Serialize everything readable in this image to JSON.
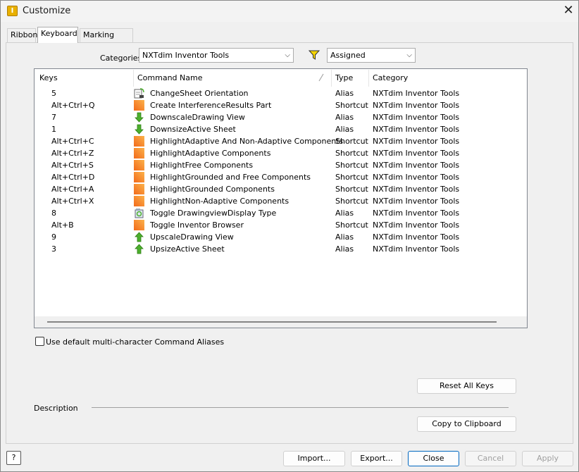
{
  "window": {
    "title": "Customize",
    "close_glyph": "✕",
    "app_icon_letter": "I"
  },
  "tabs": [
    {
      "label": "Ribbon"
    },
    {
      "label": "Keyboard"
    },
    {
      "label": "Marking Menu"
    }
  ],
  "filters": {
    "categories_label": "Categories",
    "categories_value": "NXTdim Inventor Tools",
    "filter_value": "Assigned",
    "chevron": "⌵"
  },
  "table": {
    "columns": [
      "Keys",
      "Command Name",
      "Type",
      "Category"
    ],
    "rows": [
      {
        "keys": "5",
        "command": "ChangeSheet Orientation",
        "type": "Alias",
        "category": "NXTdim Inventor Tools",
        "icon": "sheet-orientation-icon"
      },
      {
        "keys": "Alt+Ctrl+Q",
        "command": "Create InterferenceResults Part",
        "type": "Shortcut",
        "category": "NXTdim Inventor Tools",
        "icon": "orange-gradient-icon"
      },
      {
        "keys": "7",
        "command": "DownscaleDrawing View",
        "type": "Alias",
        "category": "NXTdim Inventor Tools",
        "icon": "green-down-arrow-icon"
      },
      {
        "keys": "1",
        "command": "DownsizeActive Sheet",
        "type": "Alias",
        "category": "NXTdim Inventor Tools",
        "icon": "green-down-arrow-icon"
      },
      {
        "keys": "Alt+Ctrl+C",
        "command": "HighlightAdaptive And Non-Adaptive Components",
        "type": "Shortcut",
        "category": "NXTdim Inventor Tools",
        "icon": "orange-gradient-icon"
      },
      {
        "keys": "Alt+Ctrl+Z",
        "command": "HighlightAdaptive Components",
        "type": "Shortcut",
        "category": "NXTdim Inventor Tools",
        "icon": "orange-gradient-icon"
      },
      {
        "keys": "Alt+Ctrl+S",
        "command": "HighlightFree Components",
        "type": "Shortcut",
        "category": "NXTdim Inventor Tools",
        "icon": "orange-gradient-icon"
      },
      {
        "keys": "Alt+Ctrl+D",
        "command": "HighlightGrounded and Free Components",
        "type": "Shortcut",
        "category": "NXTdim Inventor Tools",
        "icon": "orange-gradient-icon"
      },
      {
        "keys": "Alt+Ctrl+A",
        "command": "HighlightGrounded Components",
        "type": "Shortcut",
        "category": "NXTdim Inventor Tools",
        "icon": "orange-gradient-icon"
      },
      {
        "keys": "Alt+Ctrl+X",
        "command": "HighlightNon-Adaptive Components",
        "type": "Shortcut",
        "category": "NXTdim Inventor Tools",
        "icon": "orange-gradient-icon"
      },
      {
        "keys": "8",
        "command": "Toggle DrawingviewDisplay Type",
        "type": "Alias",
        "category": "NXTdim Inventor Tools",
        "icon": "toggle-display-icon"
      },
      {
        "keys": "Alt+B",
        "command": "Toggle Inventor Browser",
        "type": "Shortcut",
        "category": "NXTdim Inventor Tools",
        "icon": "orange-gradient-icon"
      },
      {
        "keys": "9",
        "command": "UpscaleDrawing View",
        "type": "Alias",
        "category": "NXTdim Inventor Tools",
        "icon": "green-up-arrow-icon"
      },
      {
        "keys": "3",
        "command": "UpsizeActive Sheet",
        "type": "Alias",
        "category": "NXTdim Inventor Tools",
        "icon": "green-up-arrow-icon"
      }
    ]
  },
  "options": {
    "use_default_aliases_label": "Use default multi-character Command Aliases",
    "use_default_aliases_checked": false
  },
  "buttons": {
    "reset_all_keys": "Reset All Keys",
    "copy_to_clipboard": "Copy to Clipboard",
    "import": "Import...",
    "export": "Export...",
    "close": "Close",
    "cancel": "Cancel",
    "apply": "Apply",
    "help": "?"
  },
  "description_label": "Description",
  "colors": {
    "accent": "#0067c0",
    "icon_orange": "#f26a1b",
    "icon_orange_light": "#fcb24a",
    "icon_green": "#4caf2d",
    "filter_yellow": "#f5d400"
  }
}
